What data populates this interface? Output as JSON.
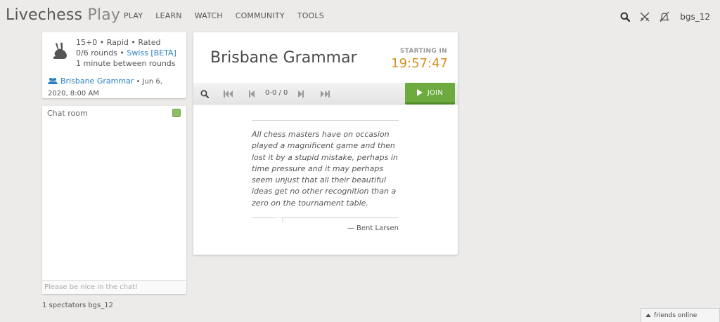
{
  "site": {
    "name": "Livechess",
    "suffix": "Play"
  },
  "nav": [
    "PLAY",
    "LEARN",
    "WATCH",
    "COMMUNITY",
    "TOOLS"
  ],
  "user": {
    "name": "bgs_12"
  },
  "icons": {
    "search": "search-icon",
    "challenge": "crossed-swords-icon",
    "notifications": "bell-slash-icon",
    "speed": "rabbit-icon",
    "team": "team-icon"
  },
  "tournament": {
    "time_control": "15+0 • Rapid • Rated",
    "rounds": "0/6 rounds •",
    "format_link": "Swiss [BETA]",
    "between_rounds": "1 minute between rounds",
    "team_name": "Brisbane Grammar",
    "date": "• Jun 6, 2020, 8:00 AM",
    "title": "Brisbane Grammar",
    "starting_label": "STARTING IN",
    "countdown": "19:57:47"
  },
  "controls": {
    "page_count": "0-0 / 0",
    "join_label": "JOIN"
  },
  "quote": {
    "text": "All chess masters have on occasion played a magnificent game and then lost it by a stupid mistake, perhaps in time pressure and it may perhaps seem unjust that all their beautiful ideas get no other recognition than a zero on the tournament table.",
    "author": "— Bent Larsen"
  },
  "chat": {
    "title": "Chat room",
    "placeholder": "Please be nice in the chat!"
  },
  "spectators": "1 spectators bgs_12",
  "friends": "friends online",
  "colors": {
    "accent_blue": "#2a7fc0",
    "countdown_orange": "#d59120",
    "join_green": "#6dab3e"
  }
}
